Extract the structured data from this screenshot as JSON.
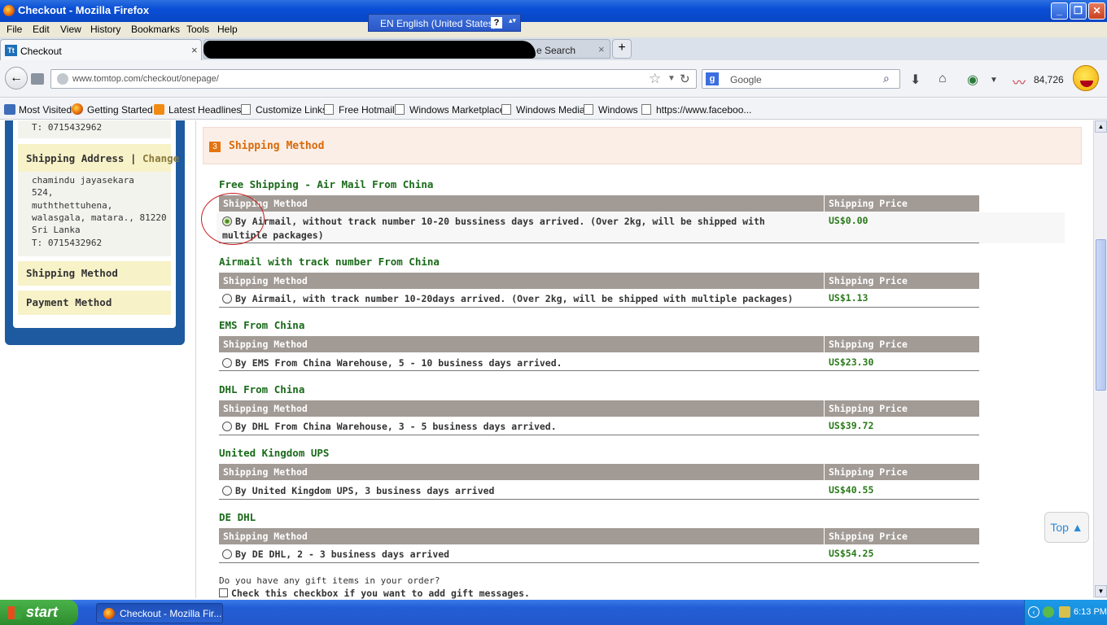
{
  "window": {
    "title": "Checkout - Mozilla Firefox"
  },
  "menu": [
    "File",
    "Edit",
    "View",
    "History",
    "Bookmarks",
    "Tools",
    "Help"
  ],
  "language_bar": {
    "label": "EN English (United States)",
    "help": "?"
  },
  "tabs": [
    {
      "label": "Checkout",
      "close": "×"
    },
    {
      "label": "e Search",
      "close": "×"
    }
  ],
  "new_tab": "+",
  "navigation": {
    "back": "←",
    "url": "www.tomtop.com/checkout/onepage/",
    "search_engine": "g",
    "search_placeholder": "Google",
    "counter": "84,726"
  },
  "bookmarks": [
    "Most Visited",
    "Getting Started",
    "Latest Headlines",
    "Customize Links",
    "Free Hotmail",
    "Windows Marketplace",
    "Windows Media",
    "Windows",
    "https://www.faceboo..."
  ],
  "sidebar": {
    "billing_phone": "T: 0715432962",
    "shipping_header": "Shipping Address",
    "shipping_sep": "|",
    "change_label": "Change",
    "address_lines": [
      "chamindu jayasekara",
      "524,",
      "muththettuhena,",
      "walasgala, matara., 81220",
      "Sri Lanka",
      "T: 0715432962"
    ],
    "shipping_method": "Shipping Method",
    "payment_method": "Payment Method"
  },
  "section": {
    "number": "3",
    "title": "Shipping Method"
  },
  "table_headers": {
    "method": "Shipping Method",
    "price": "Shipping Price"
  },
  "groups": [
    {
      "title": "Free Shipping - Air Mail From China",
      "option": "By Airmail, without track number 10-20 bussiness days arrived. (Over 2kg, will be shipped with multiple packages)",
      "price": "US$0.00",
      "selected": true
    },
    {
      "title": "Airmail with track number From China",
      "option": "By Airmail, with track number 10-20days arrived. (Over 2kg, will be shipped with multiple packages)",
      "price": "US$1.13",
      "selected": false
    },
    {
      "title": "EMS From China",
      "option": "By EMS From China Warehouse, 5 - 10 business days arrived.",
      "price": "US$23.30",
      "selected": false
    },
    {
      "title": "DHL From China",
      "option": "By DHL From China Warehouse, 3 - 5 business days arrived.",
      "price": "US$39.72",
      "selected": false
    },
    {
      "title": "United Kingdom UPS",
      "option": "By United Kingdom UPS, 3 business days arrived",
      "price": "US$40.55",
      "selected": false
    },
    {
      "title": "DE DHL",
      "option": "By DE DHL, 2 - 3 business days arrived",
      "price": "US$54.25",
      "selected": false
    }
  ],
  "gift": {
    "question": "Do you have any gift items in your order?",
    "checkbox_label": "Check this checkbox if you want to add gift messages."
  },
  "top_button": "Top",
  "taskbar": {
    "start": "start",
    "task": "Checkout - Mozilla Fir...",
    "clock": "6:13 PM"
  }
}
